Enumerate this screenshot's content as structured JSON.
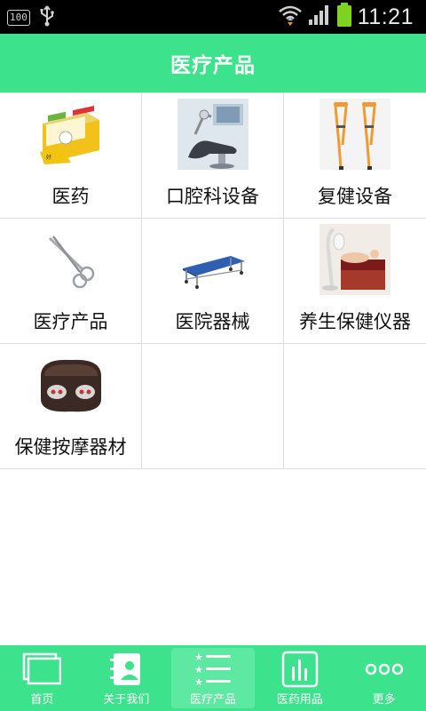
{
  "status_bar": {
    "battery_badge": "100",
    "time": "11:21"
  },
  "header": {
    "title": "医疗产品"
  },
  "products": [
    {
      "label": "医药",
      "image": "medicine-box-image"
    },
    {
      "label": "口腔科设备",
      "image": "dental-chair-image"
    },
    {
      "label": "复健设备",
      "image": "crutches-image"
    },
    {
      "label": "医疗产品",
      "image": "surgical-scissors-image"
    },
    {
      "label": "医院器械",
      "image": "stretcher-image"
    },
    {
      "label": "养生保健仪器",
      "image": "massage-bed-image"
    },
    {
      "label": "保健按摩器材",
      "image": "massage-pillow-image"
    }
  ],
  "bottom_nav": {
    "items": [
      {
        "label": "首页",
        "icon": "home-icon"
      },
      {
        "label": "关于我们",
        "icon": "contacts-icon"
      },
      {
        "label": "医疗产品",
        "icon": "list-icon"
      },
      {
        "label": "医药用品",
        "icon": "bar-chart-icon"
      },
      {
        "label": "更多",
        "icon": "more-icon"
      }
    ],
    "active_index": 2
  },
  "colors": {
    "accent": "#3ce28c",
    "status_bar": "#000000",
    "divider": "#dcdcdc"
  }
}
